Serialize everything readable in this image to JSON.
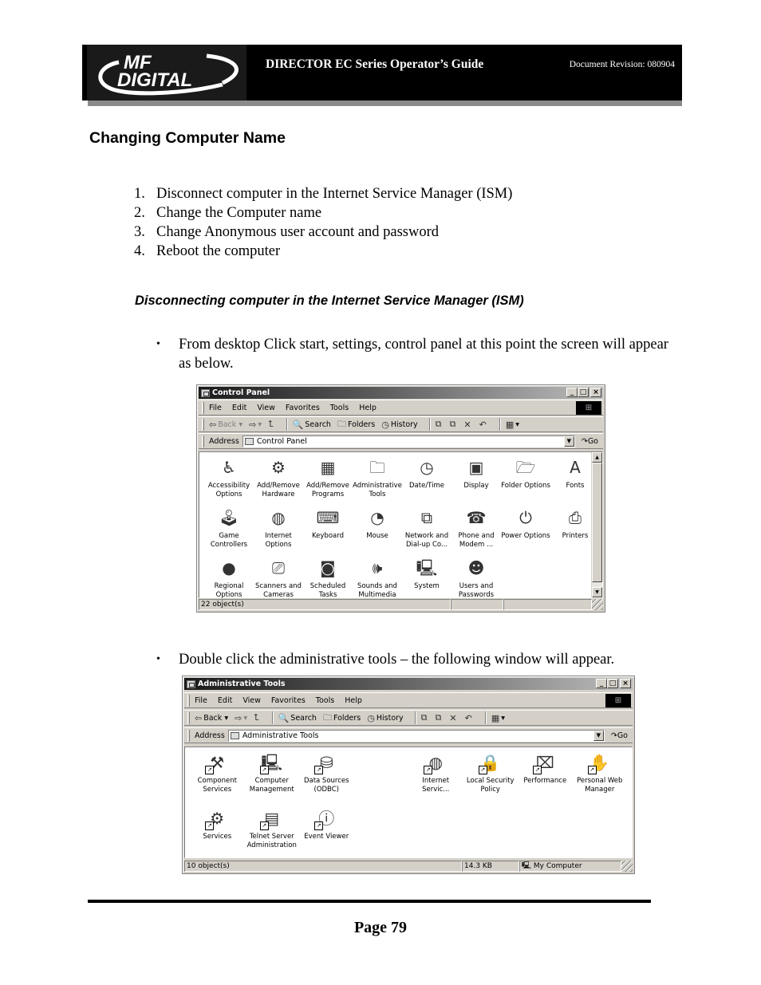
{
  "header": {
    "logo_line1": "MF",
    "logo_line2": "DIGITAL",
    "title": "DIRECTOR EC Series Operator’s Guide",
    "revision": "Document Revision: 080904"
  },
  "section_title": "Changing Computer Name",
  "steps": [
    {
      "num": "1.",
      "text": "Disconnect computer in the Internet Service Manager (ISM)"
    },
    {
      "num": "2.",
      "text": "Change the Computer name"
    },
    {
      "num": "3.",
      "text": "Change Anonymous user account and password"
    },
    {
      "num": "4.",
      "text": "Reboot the computer"
    }
  ],
  "subsection_title": "Disconnecting computer in the Internet Service Manager (ISM)",
  "bullets": [
    {
      "mark": "•",
      "text": "From desktop Click start, settings, control panel at this point the screen will appear as below."
    },
    {
      "mark": "•",
      "text": "Double click the administrative tools – the following window will appear."
    }
  ],
  "menu": [
    "File",
    "Edit",
    "View",
    "Favorites",
    "Tools",
    "Help"
  ],
  "toolbar": {
    "back": "Back",
    "search": "Search",
    "folders": "Folders",
    "history": "History",
    "address_label": "Address",
    "go": "Go"
  },
  "window_buttons": {
    "minimize": "_",
    "maximize": "□",
    "close": "×"
  },
  "control_panel": {
    "title": "Control Panel",
    "address": "Control Panel",
    "items": [
      {
        "label": "Accessibility Options",
        "icon": "accessibility-icon",
        "glyph": "♿"
      },
      {
        "label": "Add/Remove Hardware",
        "icon": "hardware-icon",
        "glyph": "⚙"
      },
      {
        "label": "Add/Remove Programs",
        "icon": "programs-icon",
        "glyph": "▦"
      },
      {
        "label": "Administrative Tools",
        "icon": "admin-tools-icon",
        "glyph": "🗀"
      },
      {
        "label": "Date/Time",
        "icon": "clock-icon",
        "glyph": "◷"
      },
      {
        "label": "Display",
        "icon": "monitor-icon",
        "glyph": "▣"
      },
      {
        "label": "Folder Options",
        "icon": "folder-options-icon",
        "glyph": "🗁"
      },
      {
        "label": "Fonts",
        "icon": "fonts-icon",
        "glyph": "A"
      },
      {
        "label": "Game Controllers",
        "icon": "joystick-icon",
        "glyph": "🕹"
      },
      {
        "label": "Internet Options",
        "icon": "globe-icon",
        "glyph": "◍"
      },
      {
        "label": "Keyboard",
        "icon": "keyboard-icon",
        "glyph": "⌨"
      },
      {
        "label": "Mouse",
        "icon": "mouse-icon",
        "glyph": "◔"
      },
      {
        "label": "Network and Dial-up Co...",
        "icon": "network-icon",
        "glyph": "⧉"
      },
      {
        "label": "Phone and Modem ...",
        "icon": "phone-icon",
        "glyph": "☎"
      },
      {
        "label": "Power Options",
        "icon": "power-icon",
        "glyph": "⏻"
      },
      {
        "label": "Printers",
        "icon": "printer-icon",
        "glyph": "⎙"
      },
      {
        "label": "Regional Options",
        "icon": "globe-regional-icon",
        "glyph": "●"
      },
      {
        "label": "Scanners and Cameras",
        "icon": "scanner-icon",
        "glyph": "⎚"
      },
      {
        "label": "Scheduled Tasks",
        "icon": "scheduled-tasks-icon",
        "glyph": "◙"
      },
      {
        "label": "Sounds and Multimedia",
        "icon": "speaker-icon",
        "glyph": "🕪"
      },
      {
        "label": "System",
        "icon": "computer-icon",
        "glyph": "🖳"
      },
      {
        "label": "Users and Passwords",
        "icon": "users-icon",
        "glyph": "☻"
      }
    ],
    "status": {
      "objects": "22 object(s)",
      "size": "",
      "zone": ""
    }
  },
  "admin_tools": {
    "title": "Administrative Tools",
    "address": "Administrative Tools",
    "items": [
      {
        "label": "Component Services",
        "icon": "component-services-icon",
        "glyph": "⚒",
        "col": 1
      },
      {
        "label": "Computer Management",
        "icon": "computer-management-icon",
        "glyph": "🖳",
        "col": 2
      },
      {
        "label": "Data Sources (ODBC)",
        "icon": "data-sources-icon",
        "glyph": "⛁",
        "col": 3
      },
      {
        "label": "Internet Servic...",
        "icon": "internet-services-icon",
        "glyph": "◍",
        "col": 5
      },
      {
        "label": "Local Security Policy",
        "icon": "security-policy-icon",
        "glyph": "🔒",
        "col": 6
      },
      {
        "label": "Performance",
        "icon": "performance-icon",
        "glyph": "⌧",
        "col": 7
      },
      {
        "label": "Personal Web Manager",
        "icon": "web-manager-icon",
        "glyph": "✋",
        "col": 8
      },
      {
        "label": "Services",
        "icon": "services-icon",
        "glyph": "⚙",
        "col": 1
      },
      {
        "label": "Telnet Server Administration",
        "icon": "telnet-icon",
        "glyph": "▤",
        "col": 2
      },
      {
        "label": "Event Viewer",
        "icon": "event-viewer-icon",
        "glyph": "ⓘ",
        "col": 3
      }
    ],
    "status": {
      "objects": "10 object(s)",
      "size": "14.3 KB",
      "zone": "My Computer"
    }
  },
  "footer": {
    "page": "Page 79"
  }
}
